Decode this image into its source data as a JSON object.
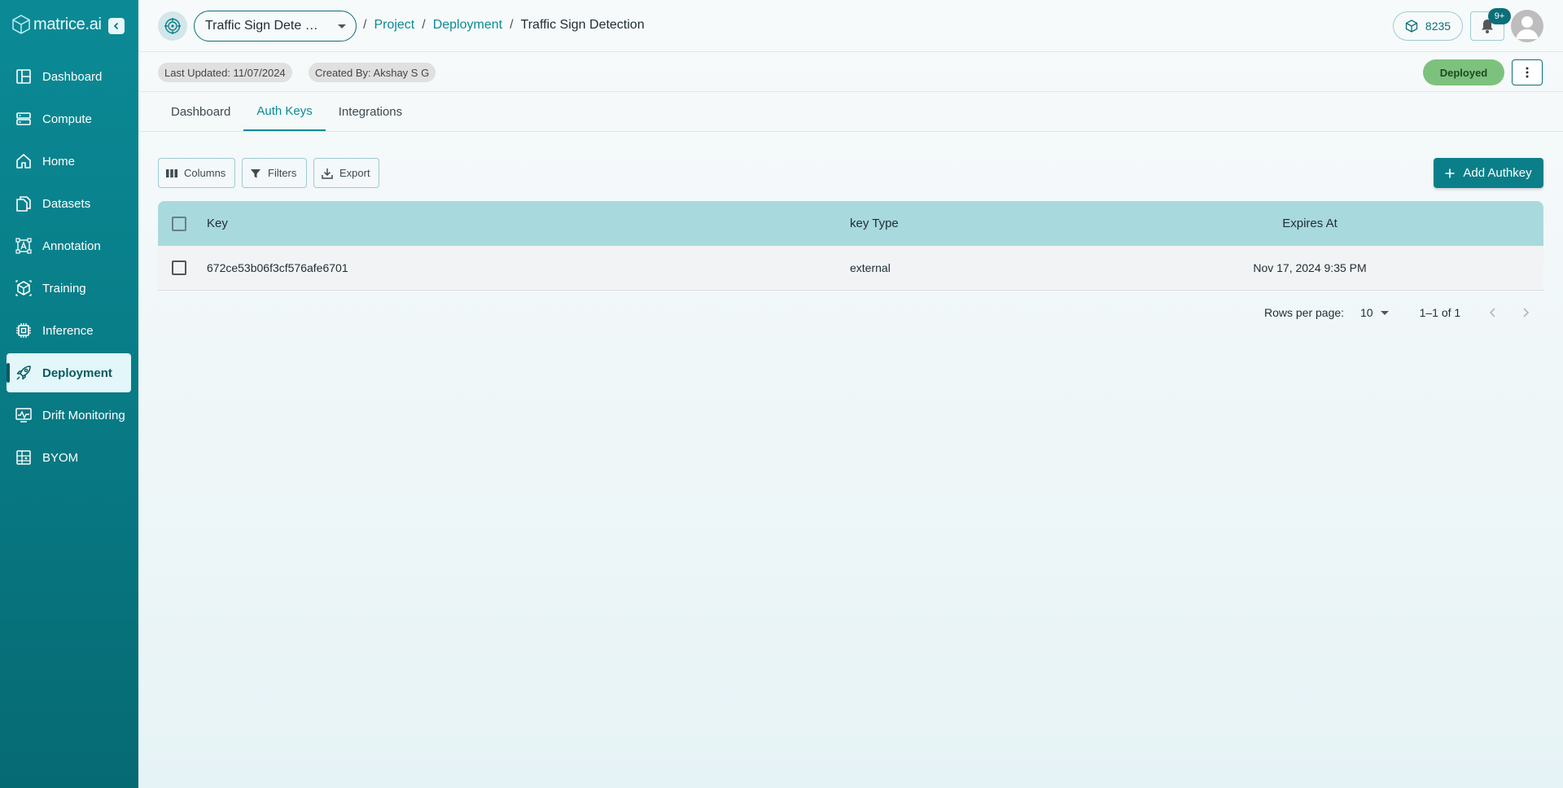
{
  "app": {
    "logo_text": "matrice.ai"
  },
  "sidebar": {
    "items": [
      {
        "label": "Dashboard",
        "icon": "dashboard-icon"
      },
      {
        "label": "Compute",
        "icon": "server-icon"
      },
      {
        "label": "Home",
        "icon": "home-icon"
      },
      {
        "label": "Datasets",
        "icon": "files-icon"
      },
      {
        "label": "Annotation",
        "icon": "annotation-icon"
      },
      {
        "label": "Training",
        "icon": "training-icon"
      },
      {
        "label": "Inference",
        "icon": "chip-icon"
      },
      {
        "label": "Deployment",
        "icon": "rocket-icon",
        "active": true
      },
      {
        "label": "Drift Monitoring",
        "icon": "monitor-chart-icon"
      },
      {
        "label": "BYOM",
        "icon": "model-icon"
      }
    ]
  },
  "header": {
    "project_select": "Traffic Sign Dete …",
    "breadcrumb": {
      "project": "Project",
      "deployment": "Deployment",
      "current": "Traffic Sign Detection",
      "sep": "/"
    },
    "credits": "8235",
    "notification_badge": "9+"
  },
  "meta": {
    "last_updated": "Last Updated: 11/07/2024",
    "created_by": "Created By: Akshay S G",
    "status": "Deployed",
    "status_color": "#7cc27d"
  },
  "tabs": [
    {
      "label": "Dashboard"
    },
    {
      "label": "Auth Keys",
      "active": true
    },
    {
      "label": "Integrations"
    }
  ],
  "toolbar": {
    "columns": "Columns",
    "filters": "Filters",
    "export": "Export",
    "add": "Add Authkey"
  },
  "table": {
    "headers": {
      "key": "Key",
      "type": "key Type",
      "expires": "Expires At"
    },
    "rows": [
      {
        "key": "672ce53b06f3cf576afe6701",
        "type": "external",
        "expires": "Nov 17, 2024 9:35 PM"
      }
    ]
  },
  "pagination": {
    "rows_per_page_label": "Rows per page:",
    "rows_per_page": "10",
    "range": "1–1 of 1"
  },
  "colors": {
    "accent": "#0b8a96",
    "sidebar": "#087d87",
    "table_header": "#a8d9dd"
  }
}
